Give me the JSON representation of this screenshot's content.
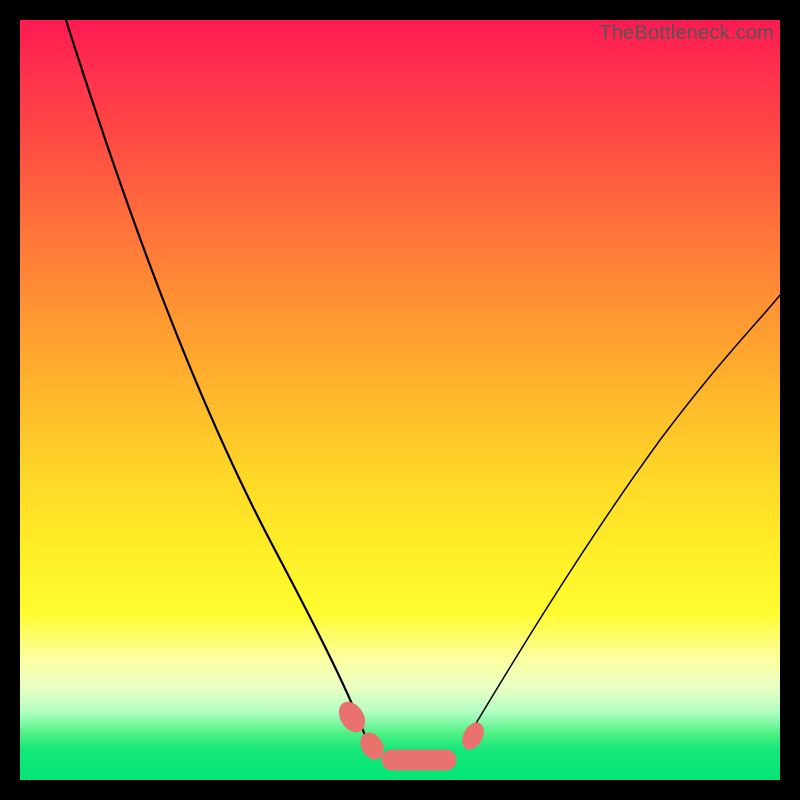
{
  "watermark": "TheBottleneck.com",
  "colors": {
    "background": "#000000",
    "gradient_top": "#ff1a52",
    "gradient_mid": "#ffee28",
    "gradient_bottom": "#00e676",
    "curve": "#000000",
    "blob": "#e9726e"
  },
  "chart_data": {
    "type": "line",
    "title": "",
    "xlabel": "",
    "ylabel": "",
    "xlim": [
      0,
      100
    ],
    "ylim": [
      0,
      100
    ],
    "grid": false,
    "legend": false,
    "annotations": [
      "TheBottleneck.com"
    ],
    "series": [
      {
        "name": "left-curve",
        "x": [
          6,
          12,
          18,
          24,
          30,
          36,
          40,
          43,
          45,
          47
        ],
        "y": [
          100,
          80,
          62,
          47,
          34,
          22,
          14,
          9,
          6,
          3
        ]
      },
      {
        "name": "right-curve",
        "x": [
          59,
          62,
          66,
          72,
          80,
          90,
          100
        ],
        "y": [
          3,
          8,
          15,
          25,
          38,
          52,
          64
        ]
      },
      {
        "name": "bottom-flat",
        "x": [
          47,
          50,
          53,
          56,
          59
        ],
        "y": [
          3,
          2,
          2,
          2,
          3
        ]
      }
    ],
    "markers": [
      {
        "name": "left-blob-upper",
        "x": 44,
        "y": 8
      },
      {
        "name": "left-blob-lower",
        "x": 47,
        "y": 4
      },
      {
        "name": "bottom-blob",
        "x": 52,
        "y": 2
      },
      {
        "name": "right-blob",
        "x": 60,
        "y": 5
      }
    ]
  }
}
